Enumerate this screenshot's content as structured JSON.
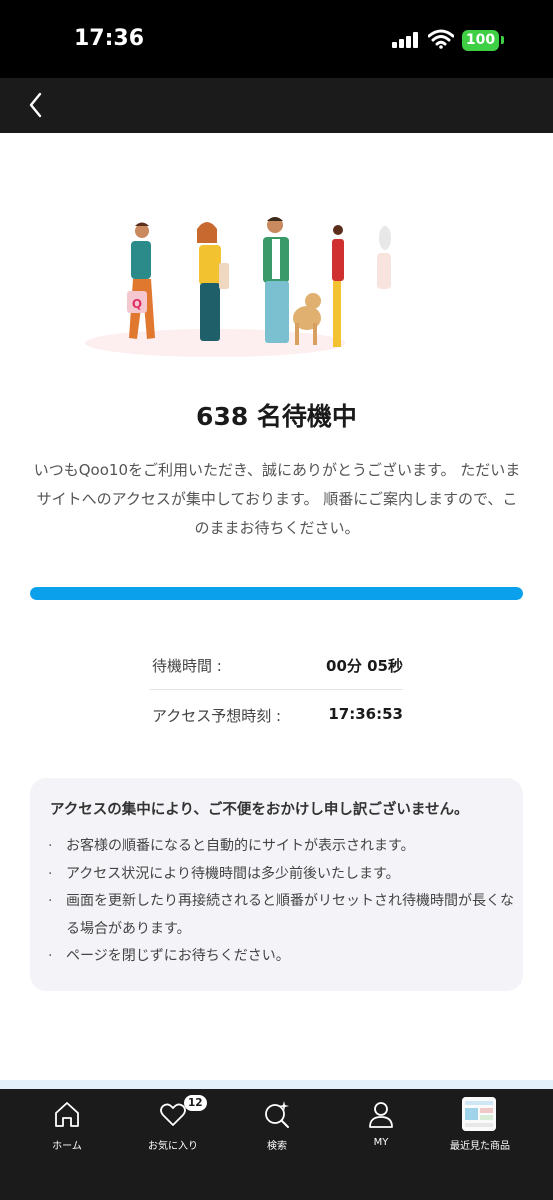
{
  "status_bar": {
    "time": "17:36",
    "battery": "100"
  },
  "queue": {
    "count_text": "638 名待機中"
  },
  "message": "いつもQoo10をご利用いただき、誠にありがとうございます。 ただいまサイトへのアクセスが集中しております。 順番にご案内しますので、このままお待ちください。",
  "progress": {
    "fraction": 1.0
  },
  "info": {
    "wait_label": "待機時間 :",
    "wait_value": "00分 05秒",
    "eta_label": "アクセス予想時刻 :",
    "eta_value": "17:36:53"
  },
  "notice": {
    "title": "アクセスの集中により、ご不便をおかけし申し訳ございません。",
    "items": [
      "お客様の順番になると自動的にサイトが表示されます。",
      "アクセス状況により待機時間は多少前後いたします。",
      "画面を更新したり再接続されると順番がリセットされ待機時間が長くなる場合があります。",
      "ページを閉じずにお待ちください。"
    ]
  },
  "tabs": [
    {
      "label": "ホーム",
      "icon": "home-icon"
    },
    {
      "label": "お気に入り",
      "icon": "heart-icon",
      "badge": "12"
    },
    {
      "label": "検索",
      "icon": "search-icon"
    },
    {
      "label": "MY",
      "icon": "user-icon"
    },
    {
      "label": "最近見た商品",
      "icon": "recent-item-thumbnail"
    }
  ],
  "colors": {
    "accent": "#0aa0ec",
    "bar": "#1b1b1b",
    "battery": "#3ecf45"
  }
}
